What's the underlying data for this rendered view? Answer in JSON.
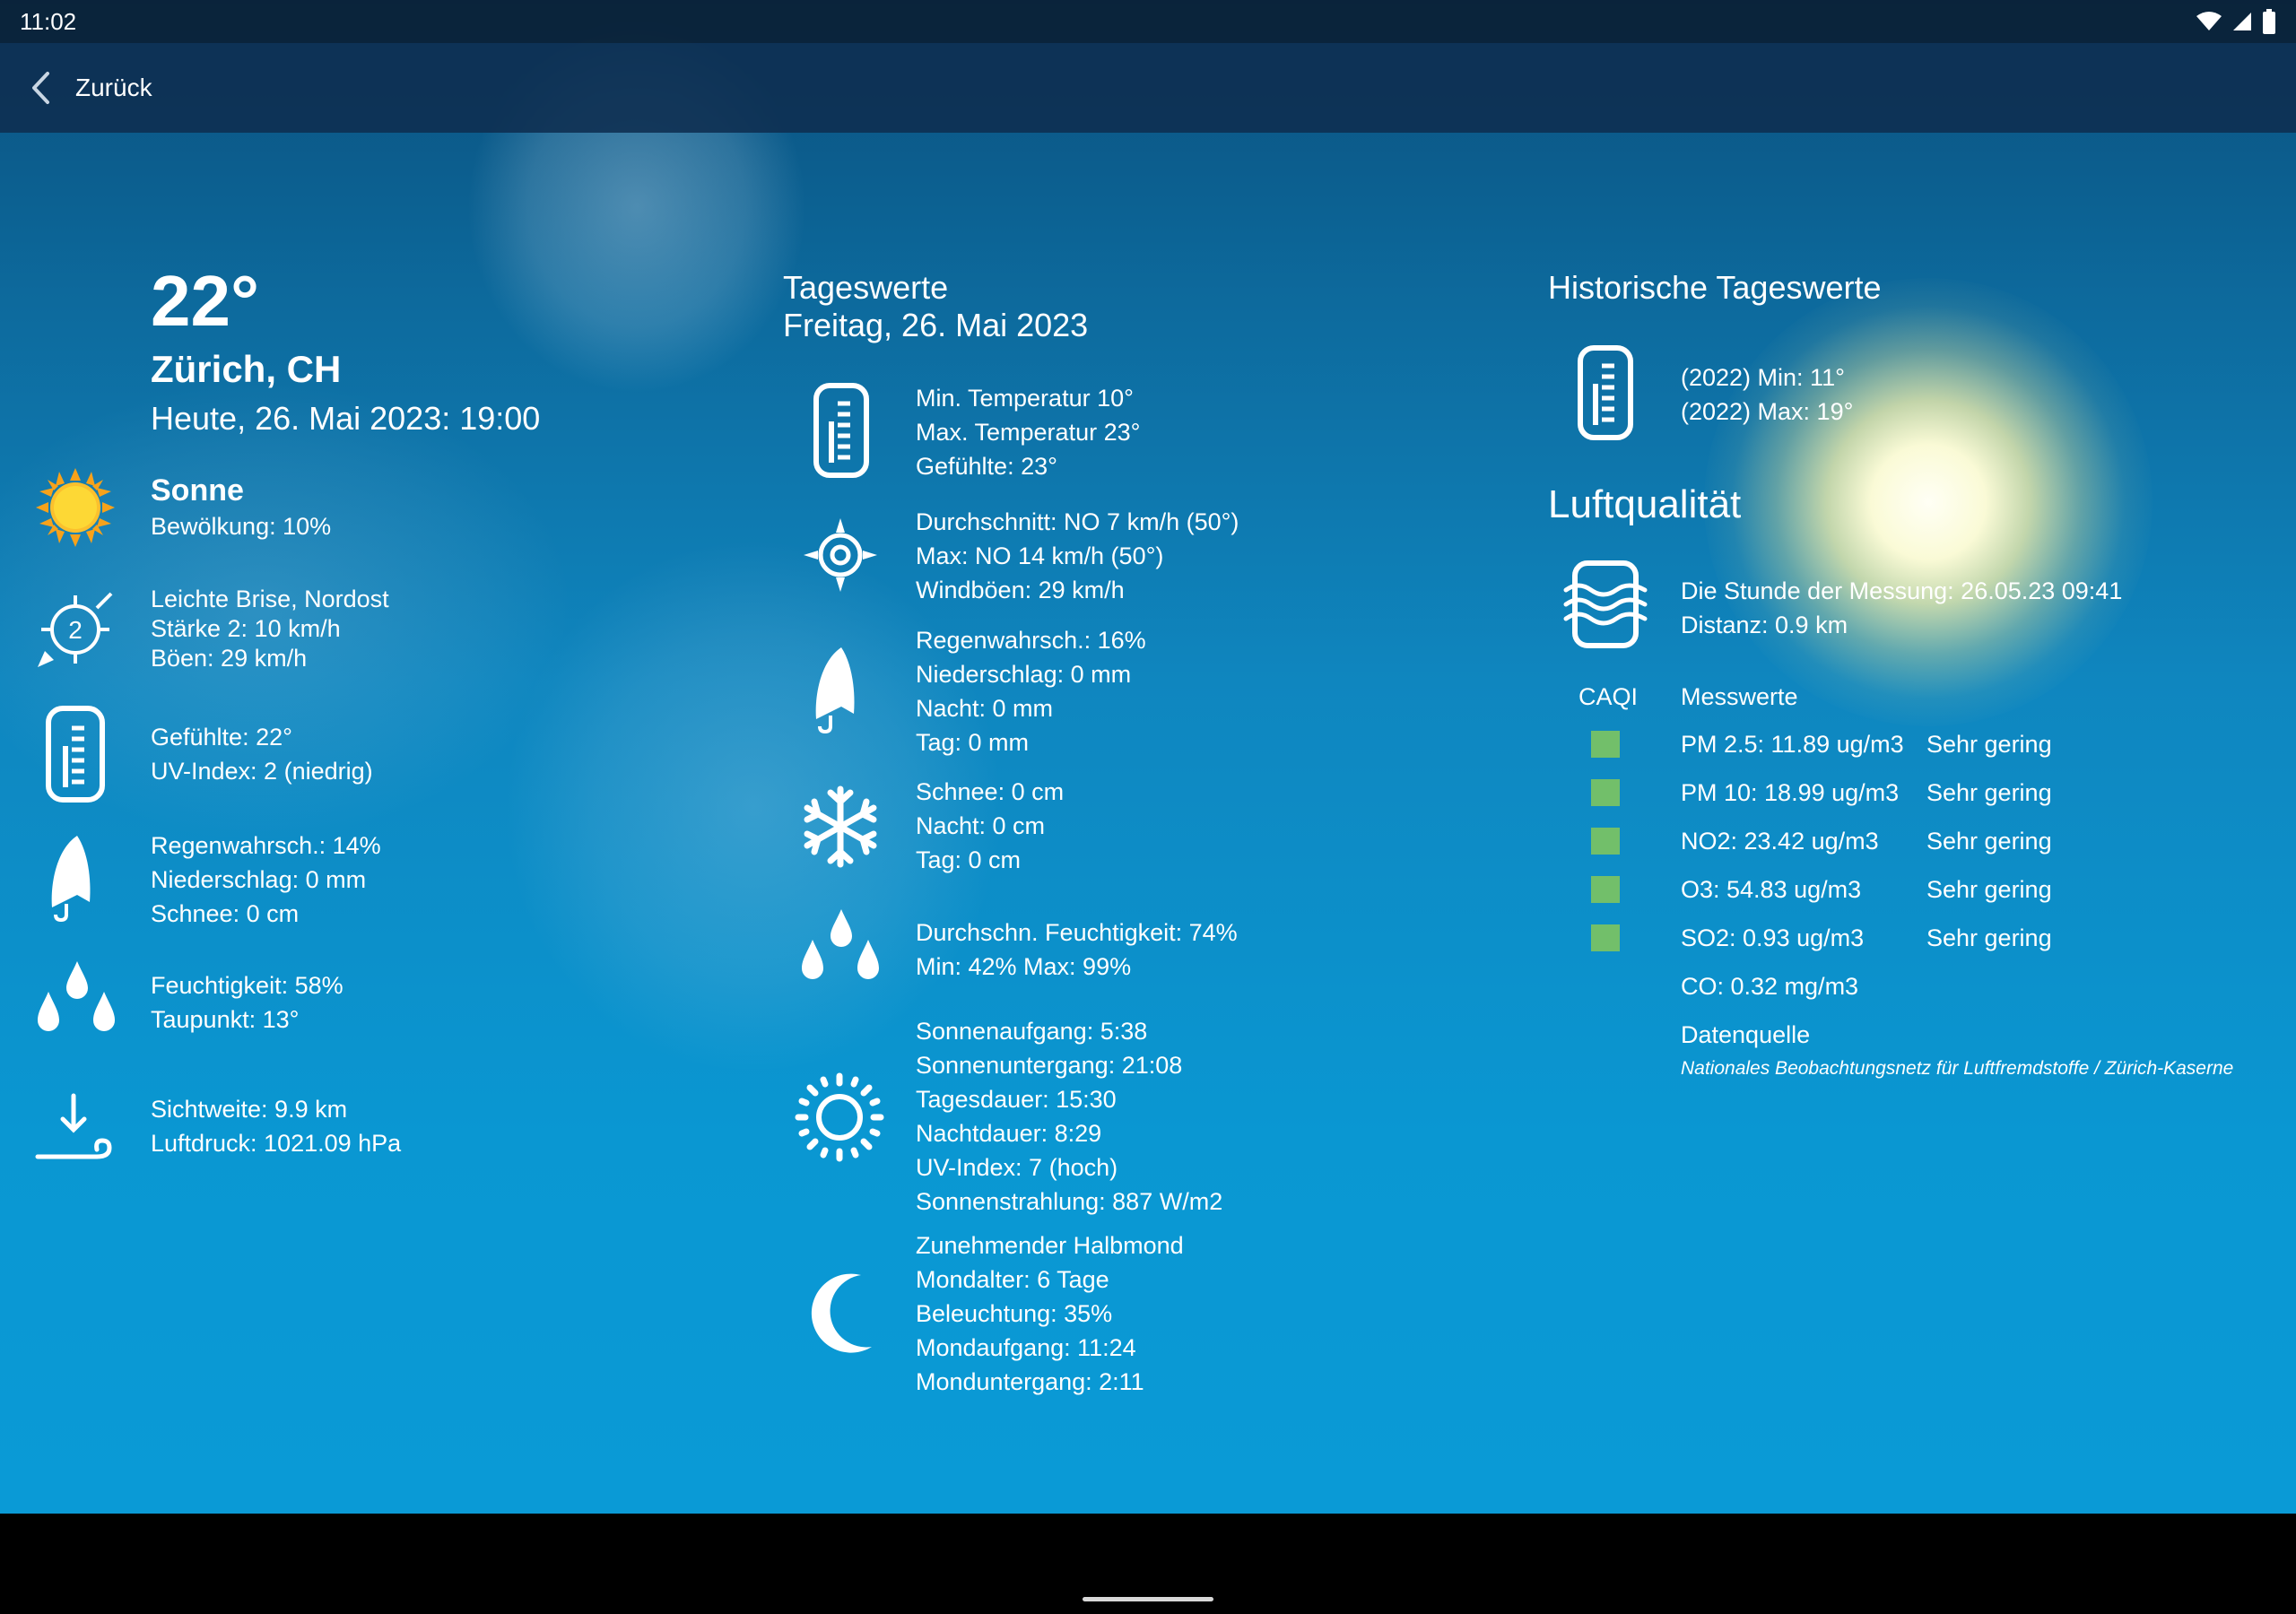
{
  "status": {
    "time": "11:02"
  },
  "appbar": {
    "back_label": "Zurück"
  },
  "current": {
    "temperature": "22°",
    "city": "Zürich, CH",
    "datetime": "Heute, 26. Mai 2023: 19:00",
    "condition": {
      "title": "Sonne",
      "line": "Bewölkung: 10%"
    },
    "wind": {
      "lines": [
        "Leichte Brise, Nordost",
        "Stärke 2: 10 km/h",
        "Böen: 29 km/h"
      ],
      "badge": "2"
    },
    "feels": {
      "lines": [
        "Gefühlte: 22°",
        "UV-Index: 2 (niedrig)"
      ]
    },
    "rain": {
      "lines": [
        "Regenwahrsch.: 14%",
        "Niederschlag: 0 mm",
        "Schnee: 0 cm"
      ]
    },
    "humidity": {
      "lines": [
        "Feuchtigkeit: 58%",
        "Taupunkt: 13°"
      ]
    },
    "pressure": {
      "lines": [
        "Sichtweite: 9.9 km",
        "Luftdruck: 1021.09 hPa"
      ]
    }
  },
  "daily": {
    "title": "Tageswerte",
    "date": "Freitag, 26. Mai 2023",
    "temp": [
      "Min. Temperatur 10°",
      "Max. Temperatur 23°",
      "Gefühlte: 23°"
    ],
    "wind": [
      "Durchschnitt: NO 7 km/h (50°)",
      "Max: NO 14 km/h (50°)",
      "Windböen: 29 km/h"
    ],
    "rain": [
      "Regenwahrsch.: 16%",
      "Niederschlag: 0 mm",
      "Nacht: 0 mm",
      "Tag: 0 mm"
    ],
    "snow": [
      "Schnee: 0 cm",
      "Nacht: 0 cm",
      "Tag: 0 cm"
    ],
    "humidity": [
      "Durchschn. Feuchtigkeit: 74%",
      "Min: 42% Max: 99%"
    ],
    "sun": [
      "Sonnenaufgang: 5:38",
      "Sonnenuntergang: 21:08",
      "Tagesdauer: 15:30",
      "Nachtdauer: 8:29",
      "UV-Index: 7 (hoch)",
      "Sonnenstrahlung: 887 W/m2"
    ],
    "moon": [
      "Zunehmender Halbmond",
      "Mondalter: 6 Tage",
      "Beleuchtung: 35%",
      "Mondaufgang: 11:24",
      "Monduntergang: 2:11"
    ]
  },
  "history": {
    "title": "Historische Tageswerte",
    "lines": [
      "(2022) Min: 11°",
      "(2022) Max: 19°"
    ]
  },
  "air": {
    "title": "Luftqualität",
    "station": [
      "Die Stunde der Messung: 26.05.23 09:41",
      "Distanz: 0.9 km"
    ],
    "col_caqi": "CAQI",
    "col_values": "Messwerte",
    "color_good": "#72bf6a",
    "rows": [
      {
        "label": "PM 2.5: 11.89 ug/m3",
        "rating": "Sehr gering"
      },
      {
        "label": "PM 10: 18.99 ug/m3",
        "rating": "Sehr gering"
      },
      {
        "label": "NO2: 23.42 ug/m3",
        "rating": "Sehr gering"
      },
      {
        "label": "O3: 54.83 ug/m3",
        "rating": "Sehr gering"
      },
      {
        "label": "SO2: 0.93 ug/m3",
        "rating": "Sehr gering"
      }
    ],
    "co": "CO: 0.32 mg/m3",
    "source_title": "Datenquelle",
    "source_text": "Nationales Beobachtungsnetz für Luftfremdstoffe / Zürich-Kaserne"
  }
}
